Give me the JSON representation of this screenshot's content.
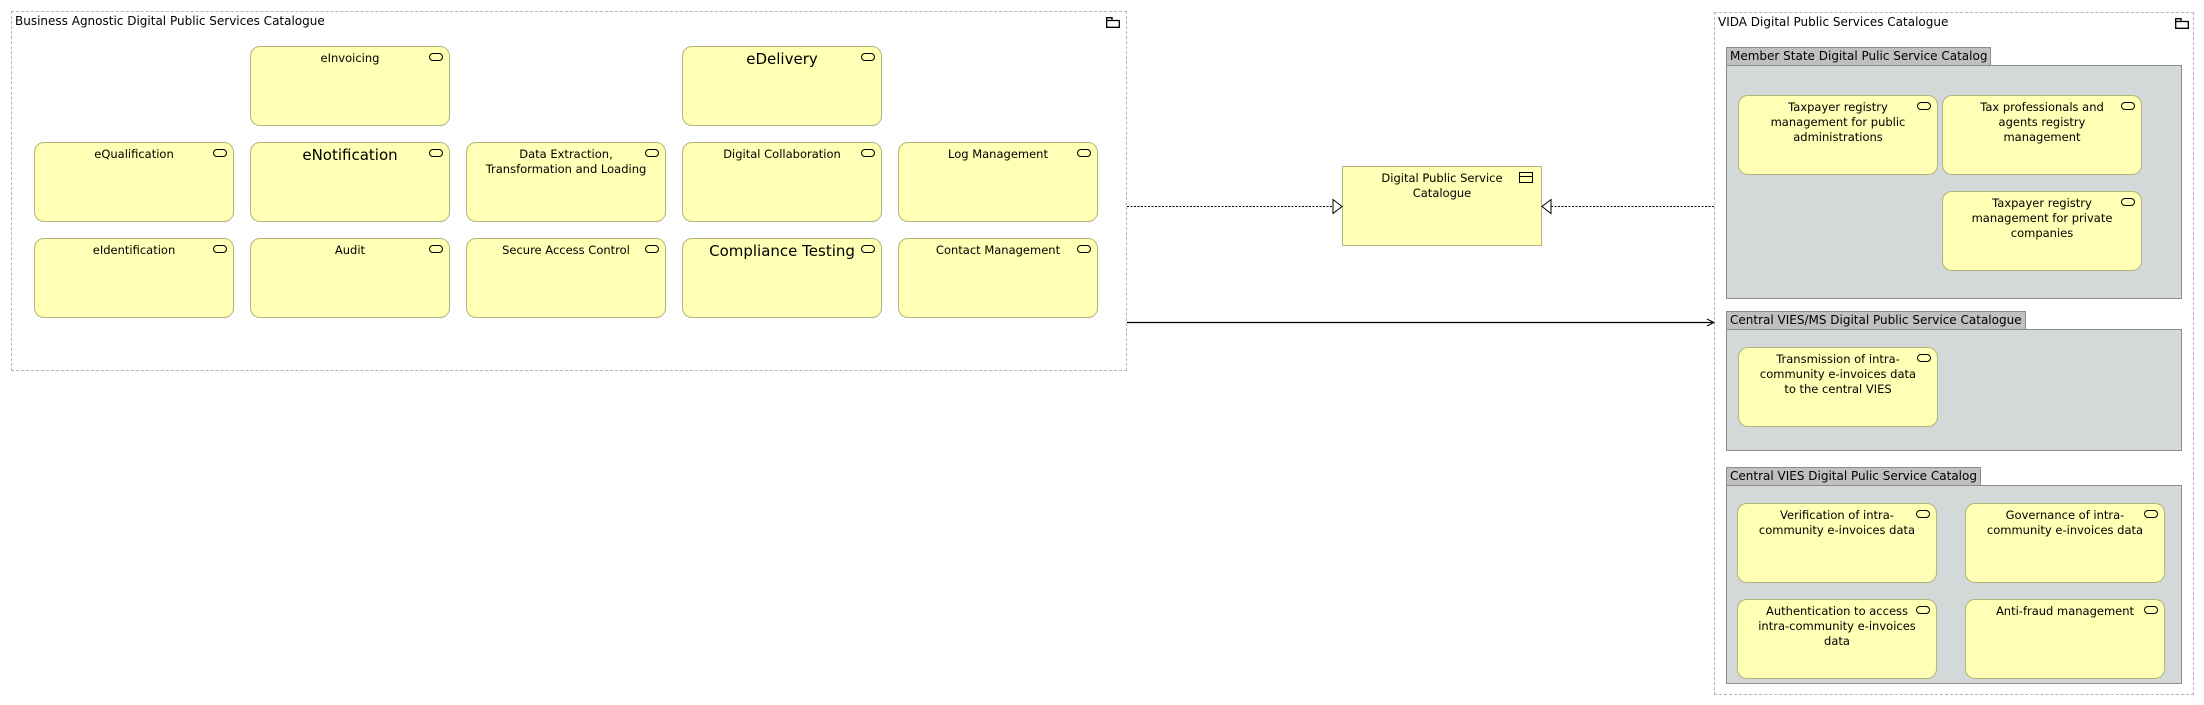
{
  "left_group": {
    "title": "Business Agnostic Digital Public Services Catalogue",
    "icon": "folder-icon",
    "services": [
      {
        "label": "eInvoicing",
        "size": "normal"
      },
      {
        "label": "eDelivery",
        "size": "big"
      },
      {
        "label": "eQualification",
        "size": "normal"
      },
      {
        "label": "eNotification",
        "size": "big"
      },
      {
        "label": "Data Extraction, Transformation and Loading",
        "size": "normal"
      },
      {
        "label": "Digital Collaboration",
        "size": "normal"
      },
      {
        "label": "Log Management",
        "size": "normal"
      },
      {
        "label": "eIdentification",
        "size": "normal"
      },
      {
        "label": "Audit",
        "size": "normal"
      },
      {
        "label": "Secure Access Control",
        "size": "normal"
      },
      {
        "label": "Compliance Testing",
        "size": "big"
      },
      {
        "label": "Contact Management",
        "size": "normal"
      }
    ]
  },
  "central_object": {
    "label": "Digital Public Service Catalogue",
    "icon": "business-object-icon"
  },
  "right_group": {
    "title": "VIDA Digital Public Services Catalogue",
    "icon": "folder-icon",
    "subgroups": [
      {
        "title": "Member State Digital Pulic Service Catalog",
        "services": [
          {
            "label": "Taxpayer registry management for public administrations"
          },
          {
            "label": "Tax professionals and agents registry management"
          },
          {
            "label": "Taxpayer registry management for private companies"
          }
        ]
      },
      {
        "title": "Central VIES/MS Digital Public Service Catalogue",
        "services": [
          {
            "label": "Transmission of intra-community e-invoices data to the central VIES"
          }
        ]
      },
      {
        "title": "Central VIES Digital Pulic Service Catalog",
        "services": [
          {
            "label": "Verification of intra-community e-invoices data"
          },
          {
            "label": "Governance of intra-community e-invoices data"
          },
          {
            "label": "Authentication to access intra-community e-invoices data"
          },
          {
            "label": "Anti-fraud management"
          }
        ]
      }
    ]
  },
  "connections": [
    {
      "from": "left_group",
      "to": "central_object",
      "type": "realization"
    },
    {
      "from": "right_group",
      "to": "central_object",
      "type": "realization"
    },
    {
      "from": "left_group",
      "to": "central-vies-ms-group",
      "type": "serving"
    }
  ],
  "colors": {
    "element_fill": "#ffffb5",
    "element_border": "#b3b37a",
    "group_fill": "#d3d8d9",
    "group_tab": "#c0c0c0",
    "group_dash": "#b4b4b4"
  }
}
